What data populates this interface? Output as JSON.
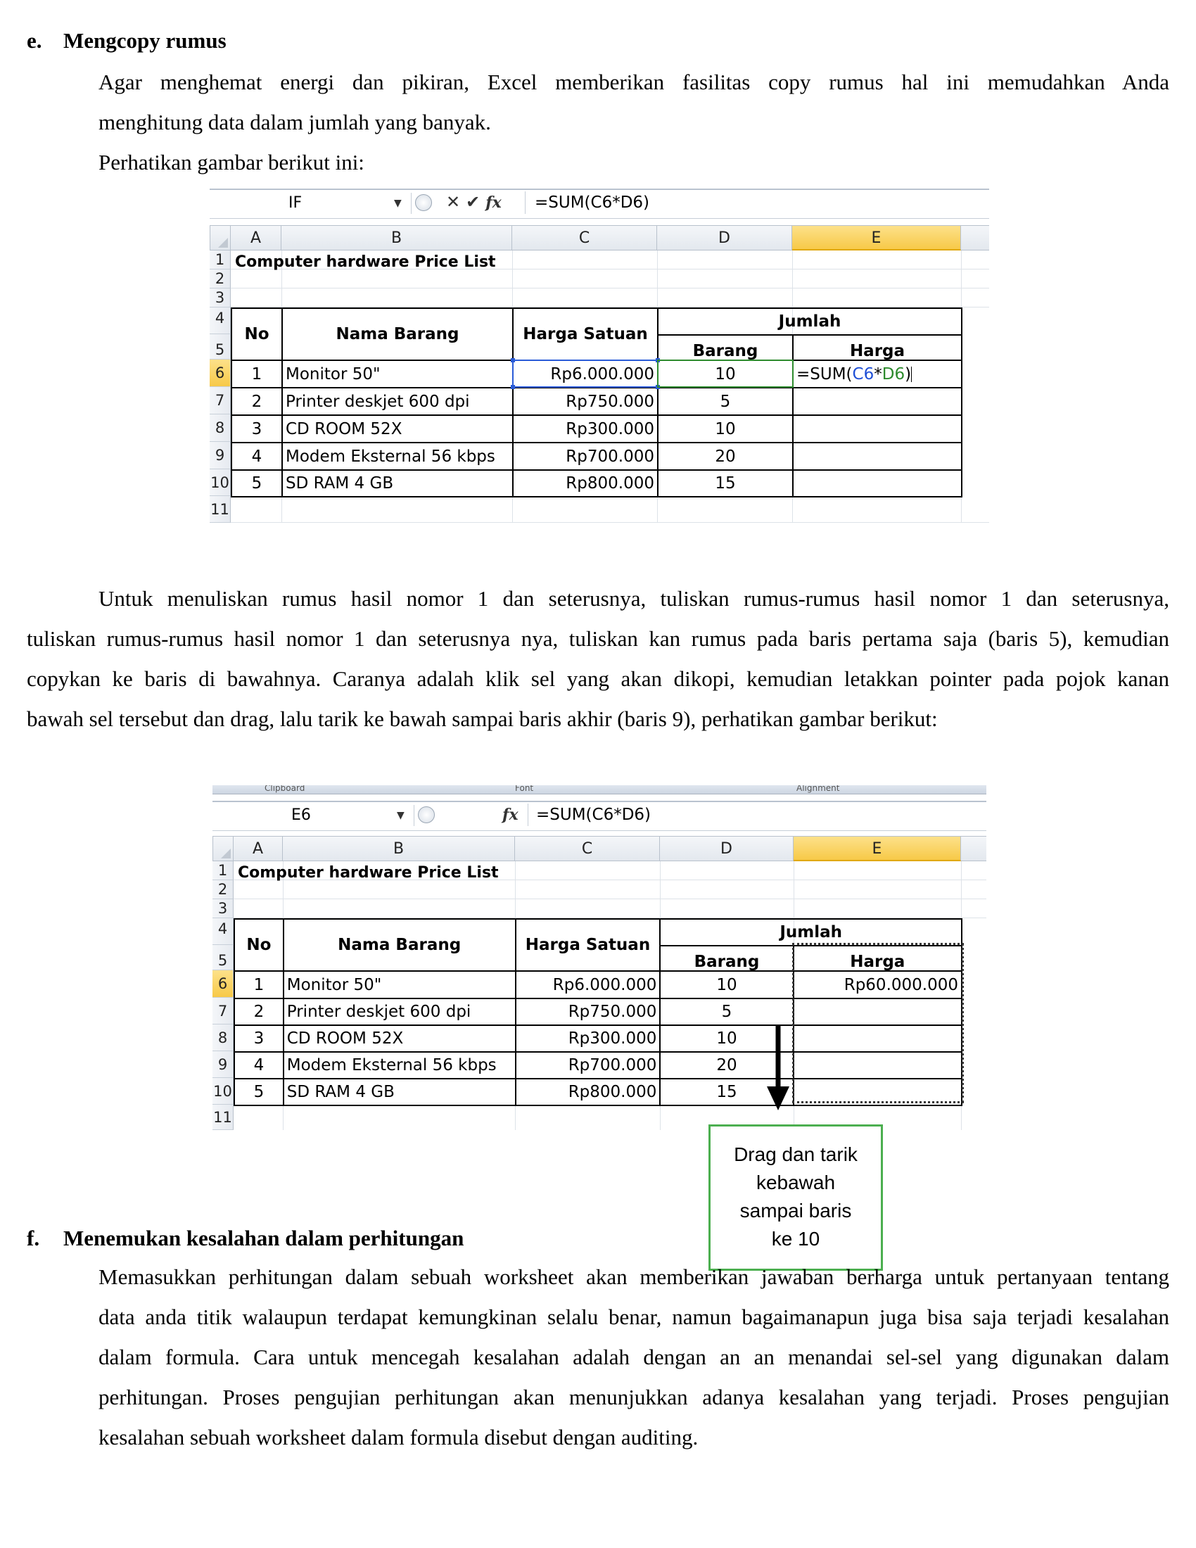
{
  "section_e": {
    "letter": "e.",
    "title": "Mengcopy rumus",
    "para1_line1": "Agar menghemat energi dan pikiran, Excel memberikan fasilitas copy rumus hal ini memudahkan Anda",
    "para1_line2": "menghitung data dalam jumlah yang banyak.",
    "para2": "Perhatikan gambar berikut ini:"
  },
  "excel1": {
    "name_box": "IF",
    "formula": "=SUM(C6*D6)",
    "columns": [
      "A",
      "B",
      "C",
      "D",
      "E"
    ],
    "rows": [
      "1",
      "2",
      "3",
      "4",
      "5",
      "6",
      "7",
      "8",
      "9",
      "10",
      "11"
    ],
    "editing_formula": {
      "prefix": "=SUM(",
      "ref1": "C6",
      "op": "*",
      "ref2": "D6",
      "suffix": ")"
    }
  },
  "excel2": {
    "ribbon_labels": [
      "Clipboard",
      "Font",
      "Alignment"
    ],
    "name_box": "E6",
    "formula": "=SUM(C6*D6)",
    "columns": [
      "A",
      "B",
      "C",
      "D",
      "E"
    ],
    "rows": [
      "1",
      "2",
      "3",
      "4",
      "5",
      "6",
      "7",
      "8",
      "9",
      "10",
      "11"
    ],
    "result_e6": "Rp60.000.000"
  },
  "sheet": {
    "title": "Computer hardware Price List",
    "headers": {
      "no": "No",
      "nama": "Nama Barang",
      "harga_satuan": "Harga Satuan",
      "jumlah": "Jumlah",
      "barang": "Barang",
      "harga": "Harga"
    },
    "items": [
      {
        "no": "1",
        "nama": "Monitor 50\"",
        "harga": "Rp6.000.000",
        "barang": "10"
      },
      {
        "no": "2",
        "nama": "Printer deskjet 600 dpi",
        "harga": "Rp750.000",
        "barang": "5"
      },
      {
        "no": "3",
        "nama": "CD ROOM 52X",
        "harga": "Rp300.000",
        "barang": "10"
      },
      {
        "no": "4",
        "nama": "Modem Eksternal 56 kbps",
        "harga": "Rp700.000",
        "barang": "20"
      },
      {
        "no": "5",
        "nama": "SD RAM 4 GB",
        "harga": "Rp800.000",
        "barang": "15"
      }
    ]
  },
  "middle_para": {
    "line1": "Untuk menuliskan rumus hasil nomor 1 dan seterusnya, tuliskan rumus-rumus hasil nomor 1 dan seterusnya,",
    "line2": "tuliskan rumus-rumus hasil nomor 1 dan seterusnya nya, tuliskan kan rumus pada baris pertama saja (baris 5), kemudian",
    "line3": "copykan ke baris di bawahnya. Caranya adalah klik sel yang akan dikopi, kemudian letakkan pointer pada pojok kanan",
    "line4": "bawah sel tersebut dan drag, lalu tarik ke bawah sampai baris akhir (baris 9), perhatikan gambar berikut:"
  },
  "callout": {
    "line1": "Drag dan tarik",
    "line2": "kebawah",
    "line3": "sampai baris",
    "line4": "ke 10"
  },
  "section_f": {
    "letter": "f.",
    "title": "Menemukan kesalahan dalam perhitungan",
    "line1": "Memasukkan perhitungan dalam sebuah worksheet akan memberikan jawaban berharga untuk pertanyaan tentang",
    "line2": "data anda titik walaupun terdapat kemungkinan selalu benar, namun bagaimanapun juga bisa saja terjadi kesalahan",
    "line3": "dalam formula. Cara untuk mencegah kesalahan adalah dengan an an menandai sel-sel yang digunakan dalam",
    "line4": "perhitungan. Proses pengujian perhitungan akan menunjukkan adanya kesalahan yang terjadi. Proses pengujian",
    "line5": "kesalahan sebuah worksheet dalam formula disebut dengan auditing."
  }
}
